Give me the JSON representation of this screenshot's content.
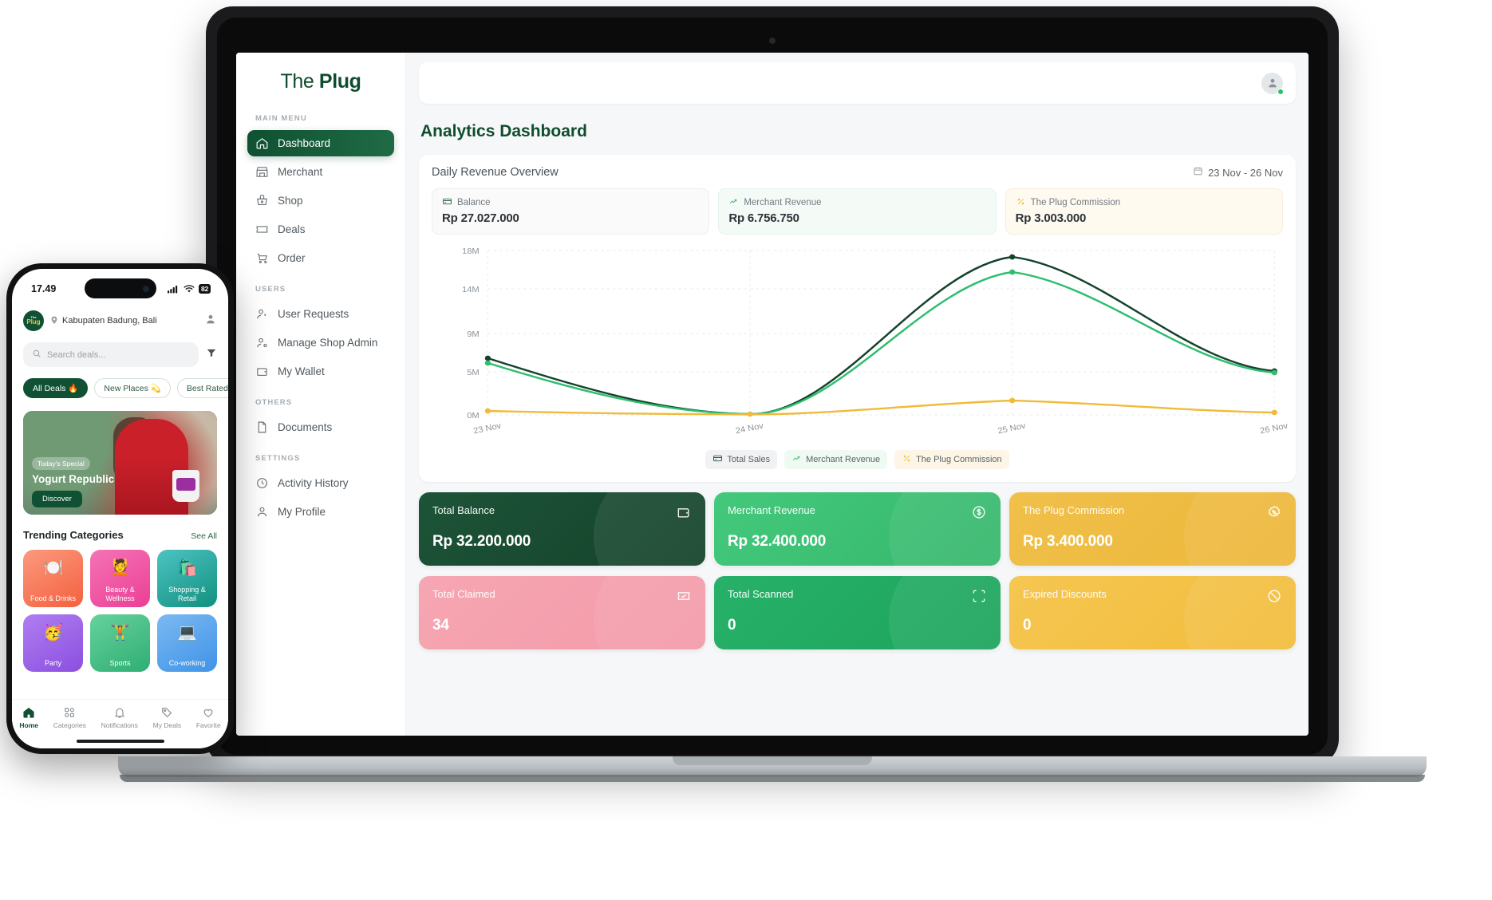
{
  "sidebar": {
    "brand_light": "The ",
    "brand_bold": "Plug",
    "sections": [
      {
        "label": "MAIN MENU",
        "items": [
          {
            "label": "Dashboard",
            "icon": "home-icon",
            "active": true
          },
          {
            "label": "Merchant",
            "icon": "store-icon",
            "active": false
          },
          {
            "label": "Shop",
            "icon": "basket-icon",
            "active": false
          },
          {
            "label": "Deals",
            "icon": "ticket-icon",
            "active": false
          },
          {
            "label": "Order",
            "icon": "cart-icon",
            "active": false
          }
        ]
      },
      {
        "label": "USERS",
        "items": [
          {
            "label": "User Requests",
            "icon": "user-question-icon",
            "active": false
          },
          {
            "label": "Manage Shop Admin",
            "icon": "user-gear-icon",
            "active": false
          },
          {
            "label": "My Wallet",
            "icon": "wallet-icon",
            "active": false
          }
        ]
      },
      {
        "label": "OTHERS",
        "items": [
          {
            "label": "Documents",
            "icon": "document-icon",
            "active": false
          }
        ]
      },
      {
        "label": "SETTINGS",
        "items": [
          {
            "label": "Activity History",
            "icon": "history-icon",
            "active": false
          },
          {
            "label": "My Profile",
            "icon": "profile-icon",
            "active": false
          }
        ]
      }
    ]
  },
  "header": {
    "avatar_icon": "user-avatar-icon",
    "status": "online"
  },
  "page": {
    "title": "Analytics Dashboard"
  },
  "revenue_panel": {
    "title": "Daily Revenue Overview",
    "date_range": "23 Nov - 26 Nov",
    "calendar_icon": "calendar-icon",
    "kpis": [
      {
        "label": "Balance",
        "value": "Rp 27.027.000",
        "icon": "card-icon",
        "color": "#0f5132"
      },
      {
        "label": "Merchant Revenue",
        "value": "Rp 6.756.750",
        "icon": "trend-up-icon",
        "color": "#2fae6a"
      },
      {
        "label": "The Plug Commission",
        "value": "Rp 3.003.000",
        "icon": "percent-icon",
        "color": "#efb83c"
      }
    ],
    "legend": [
      {
        "label": "Total Sales",
        "icon": "card-icon",
        "color": "#14422b"
      },
      {
        "label": "Merchant Revenue",
        "icon": "trend-up-icon",
        "color": "#2fbd6e"
      },
      {
        "label": "The Plug Commission",
        "icon": "percent-icon",
        "color": "#f0bb3a"
      }
    ]
  },
  "chart_data": {
    "type": "line",
    "title": "Daily Revenue Overview",
    "xlabel": "",
    "ylabel": "",
    "x": [
      "23 Nov",
      "24 Nov",
      "25 Nov",
      "26 Nov"
    ],
    "ytick_labels": [
      "0M",
      "5M",
      "9M",
      "14M",
      "18M"
    ],
    "ytick_values": [
      0,
      5000000,
      9000000,
      14000000,
      18000000
    ],
    "ylim": [
      0,
      18000000
    ],
    "grid": true,
    "legend_position": "bottom",
    "curve": "smooth",
    "series": [
      {
        "name": "Total Sales",
        "color": "#14422b",
        "values": [
          6200000,
          200000,
          17900000,
          6400000
        ]
      },
      {
        "name": "Merchant Revenue",
        "color": "#2fbd6e",
        "values": [
          5700000,
          150000,
          16300000,
          6200000
        ]
      },
      {
        "name": "The Plug Commission",
        "color": "#f0bb3a",
        "values": [
          400000,
          120000,
          1400000,
          300000
        ]
      }
    ]
  },
  "cards_row1": [
    {
      "label": "Total Balance",
      "value": "Rp 32.200.000",
      "icon": "wallet-icon",
      "theme": "c-dark"
    },
    {
      "label": "Merchant Revenue",
      "value": "Rp 32.400.000",
      "icon": "dollar-circle-icon",
      "theme": "c-green"
    },
    {
      "label": "The Plug Commission",
      "value": "Rp 3.400.000",
      "icon": "badge-percent-icon",
      "theme": "c-amber"
    }
  ],
  "cards_row2": [
    {
      "label": "Total Claimed",
      "value": "34",
      "icon": "ticket-check-icon",
      "theme": "c-pink"
    },
    {
      "label": "Total Scanned",
      "value": "0",
      "icon": "scan-icon",
      "theme": "c-green2"
    },
    {
      "label": "Expired Discounts",
      "value": "0",
      "icon": "ban-icon",
      "theme": "c-amber2"
    }
  ],
  "phone": {
    "status": {
      "time": "17.49",
      "battery": "82",
      "signal_icon": "signal-icon",
      "wifi_icon": "wifi-icon"
    },
    "logo_small": "The",
    "logo_text": "Plug",
    "location": "Kabupaten Badung, Bali",
    "profile_icon": "user-icon",
    "search": {
      "placeholder": "Search deals...",
      "icon": "search-icon"
    },
    "filter_icon": "filter-icon",
    "chips": [
      {
        "label": "All Deals 🔥",
        "active": true
      },
      {
        "label": "New Places 💫",
        "active": false
      },
      {
        "label": "Best Rated ⭐",
        "active": false
      }
    ],
    "promo": {
      "badge": "Today's Special",
      "title": "Yogurt Republic",
      "button": "Discover"
    },
    "section": {
      "title": "Trending Categories",
      "link": "See All"
    },
    "categories": [
      {
        "label": "Food & Drinks",
        "emoji": "🍽️",
        "theme": "g1"
      },
      {
        "label": "Beauty & Wellness",
        "emoji": "💆",
        "theme": "g2"
      },
      {
        "label": "Shopping & Retail",
        "emoji": "🛍️",
        "theme": "g3"
      },
      {
        "label": "Party",
        "emoji": "🥳",
        "theme": "g4"
      },
      {
        "label": "Sports",
        "emoji": "🏋️",
        "theme": "g5"
      },
      {
        "label": "Co-working",
        "emoji": "💻",
        "theme": "g6"
      }
    ],
    "tabs": [
      {
        "label": "Home",
        "icon": "home-icon",
        "active": true
      },
      {
        "label": "Categories",
        "icon": "grid-icon",
        "active": false
      },
      {
        "label": "Notifications",
        "icon": "bell-icon",
        "active": false
      },
      {
        "label": "My Deals",
        "icon": "tag-icon",
        "active": false
      },
      {
        "label": "Favorite",
        "icon": "heart-icon",
        "active": false
      }
    ]
  }
}
